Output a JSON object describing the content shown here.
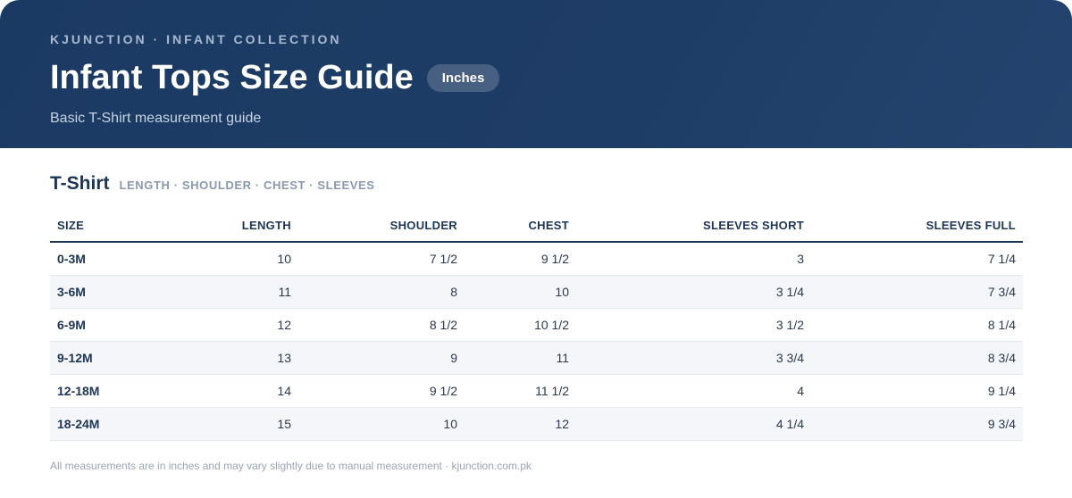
{
  "header": {
    "eyebrow": "KJUNCTION · INFANT COLLECTION",
    "title": "Infant Tops Size Guide",
    "unit_badge": "Inches",
    "subtitle": "Basic T-Shirt measurement guide"
  },
  "section": {
    "title": "T-Shirt",
    "tags": "LENGTH · SHOULDER · CHEST · SLEEVES"
  },
  "table": {
    "columns": [
      "SIZE",
      "LENGTH",
      "SHOULDER",
      "CHEST",
      "SLEEVES SHORT",
      "SLEEVES FULL"
    ],
    "rows": [
      [
        "0-3M",
        "10",
        "7 1/2",
        "9 1/2",
        "3",
        "7 1/4"
      ],
      [
        "3-6M",
        "11",
        "8",
        "10",
        "3 1/4",
        "7 3/4"
      ],
      [
        "6-9M",
        "12",
        "8 1/2",
        "10 1/2",
        "3 1/2",
        "8 1/4"
      ],
      [
        "9-12M",
        "13",
        "9",
        "11",
        "3 3/4",
        "8 3/4"
      ],
      [
        "12-18M",
        "14",
        "9 1/2",
        "11 1/2",
        "4",
        "9 1/4"
      ],
      [
        "18-24M",
        "15",
        "10",
        "12",
        "4 1/4",
        "9 3/4"
      ]
    ]
  },
  "footer": {
    "note": "All measurements are in inches and may vary slightly due to manual measurement · kjunction.com.pk"
  },
  "colors": {
    "header_bg": "#1e3d66",
    "accent": "#1d3557",
    "row_stripe": "#f4f6fa"
  }
}
